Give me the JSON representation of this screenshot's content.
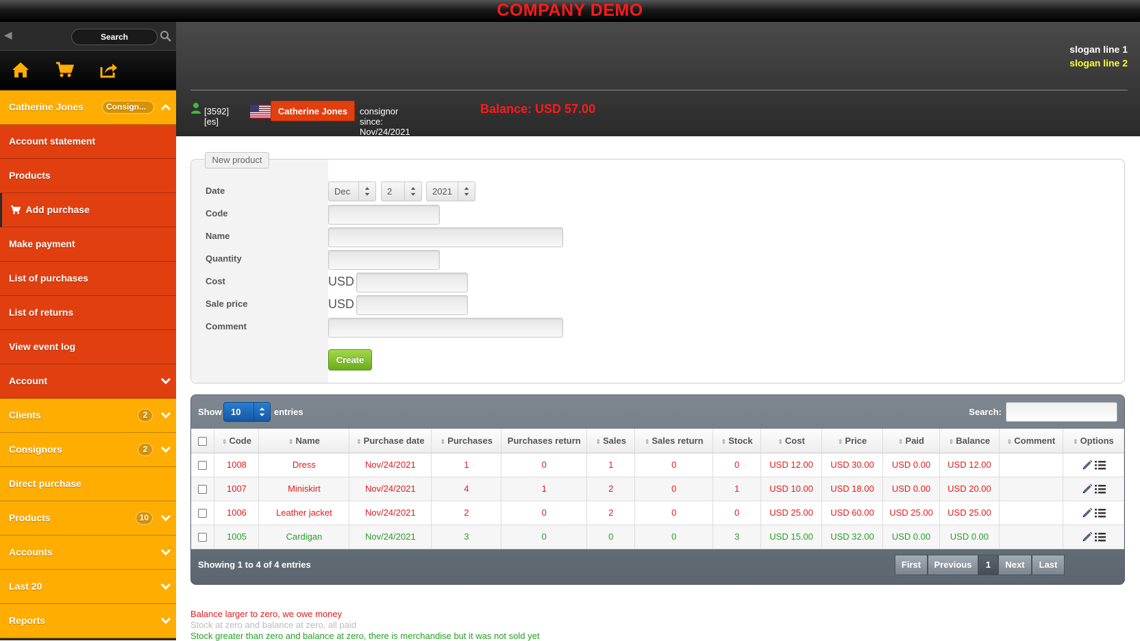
{
  "app": {
    "title": "COMPANY DEMO"
  },
  "sidebar": {
    "search_label": "Search",
    "user_item": {
      "name": "Catherine Jones",
      "role_badge": "Consign..."
    },
    "red_items": [
      {
        "label": "Account statement"
      },
      {
        "label": "Products"
      },
      {
        "label": "Add purchase"
      },
      {
        "label": "Make payment"
      },
      {
        "label": "List of purchases"
      },
      {
        "label": "List of returns"
      },
      {
        "label": "View event log"
      },
      {
        "label": "Account"
      }
    ],
    "orange_items": [
      {
        "label": "Clients",
        "badge": "2"
      },
      {
        "label": "Consignors",
        "badge": "2"
      },
      {
        "label": "Direct purchase",
        "badge": ""
      },
      {
        "label": "Products",
        "badge": "10"
      },
      {
        "label": "Accounts",
        "badge": ""
      },
      {
        "label": "Last 20",
        "badge": ""
      },
      {
        "label": "Reports",
        "badge": ""
      }
    ]
  },
  "header": {
    "slogan_line_1": "slogan line 1",
    "slogan_line_2": "slogan line 2",
    "user_id": "[3592][es]",
    "user_button": "Catherine Jones",
    "consignor_since": "consignor since: Nov/24/2021",
    "balance": "Balance: USD 57.00"
  },
  "form": {
    "legend": "New product",
    "labels": {
      "date": "Date",
      "code": "Code",
      "name": "Name",
      "quantity": "Quantity",
      "cost": "Cost",
      "sale_price": "Sale price",
      "comment": "Comment"
    },
    "date_month": "Dec",
    "date_day": "2",
    "date_year": "2021",
    "currency": "USD",
    "create_button": "Create"
  },
  "table": {
    "show_label": "Show",
    "page_length": "10",
    "entries_label": "entries",
    "search_label": "Search:",
    "columns": [
      "Code",
      "Name",
      "Purchase date",
      "Purchases",
      "Purchases return",
      "Sales",
      "Sales return",
      "Stock",
      "Cost",
      "Price",
      "Paid",
      "Balance",
      "Comment",
      "Options"
    ],
    "rows": [
      {
        "status": "red",
        "cells": [
          "1008",
          "Dress",
          "Nov/24/2021",
          "1",
          "0",
          "1",
          "0",
          "0",
          "USD 12.00",
          "USD 30.00",
          "USD 0.00",
          "USD 12.00",
          ""
        ]
      },
      {
        "status": "red",
        "cells": [
          "1007",
          "Miniskirt",
          "Nov/24/2021",
          "4",
          "1",
          "2",
          "0",
          "1",
          "USD 10.00",
          "USD 18.00",
          "USD 0.00",
          "USD 20.00",
          ""
        ]
      },
      {
        "status": "red",
        "cells": [
          "1006",
          "Leather jacket",
          "Nov/24/2021",
          "2",
          "0",
          "2",
          "0",
          "0",
          "USD 25.00",
          "USD 60.00",
          "USD 25.00",
          "USD 25.00",
          ""
        ]
      },
      {
        "status": "green",
        "cells": [
          "1005",
          "Cardigan",
          "Nov/24/2021",
          "3",
          "0",
          "0",
          "0",
          "3",
          "USD 15.00",
          "USD 32.00",
          "USD 0.00",
          "USD 0.00",
          ""
        ]
      }
    ],
    "info": "Showing 1 to 4 of 4 entries",
    "pagination": {
      "first": "First",
      "previous": "Previous",
      "current": "1",
      "next": "Next",
      "last": "Last"
    }
  },
  "legend": [
    {
      "text": "Balance larger to zero, we owe money",
      "color": "#e31a1a"
    },
    {
      "text": "Stock at zero and balance at zero, all paid",
      "color": "#bbbbbb"
    },
    {
      "text": "Stock greater than zero and balance at zero, there is merchandise but it was not sold yet",
      "color": "#24a024"
    }
  ],
  "colors": {
    "red": "#e31a1a",
    "green": "#24a024",
    "sidebar_red": "#e13f10",
    "sidebar_orange": "#ffad00"
  },
  "icons": [
    "home-icon",
    "cart-icon",
    "share-icon",
    "search-icon",
    "user-icon",
    "us-flag-icon",
    "chevron-up-icon",
    "chevron-down-icon",
    "edit-icon",
    "list-icon"
  ]
}
